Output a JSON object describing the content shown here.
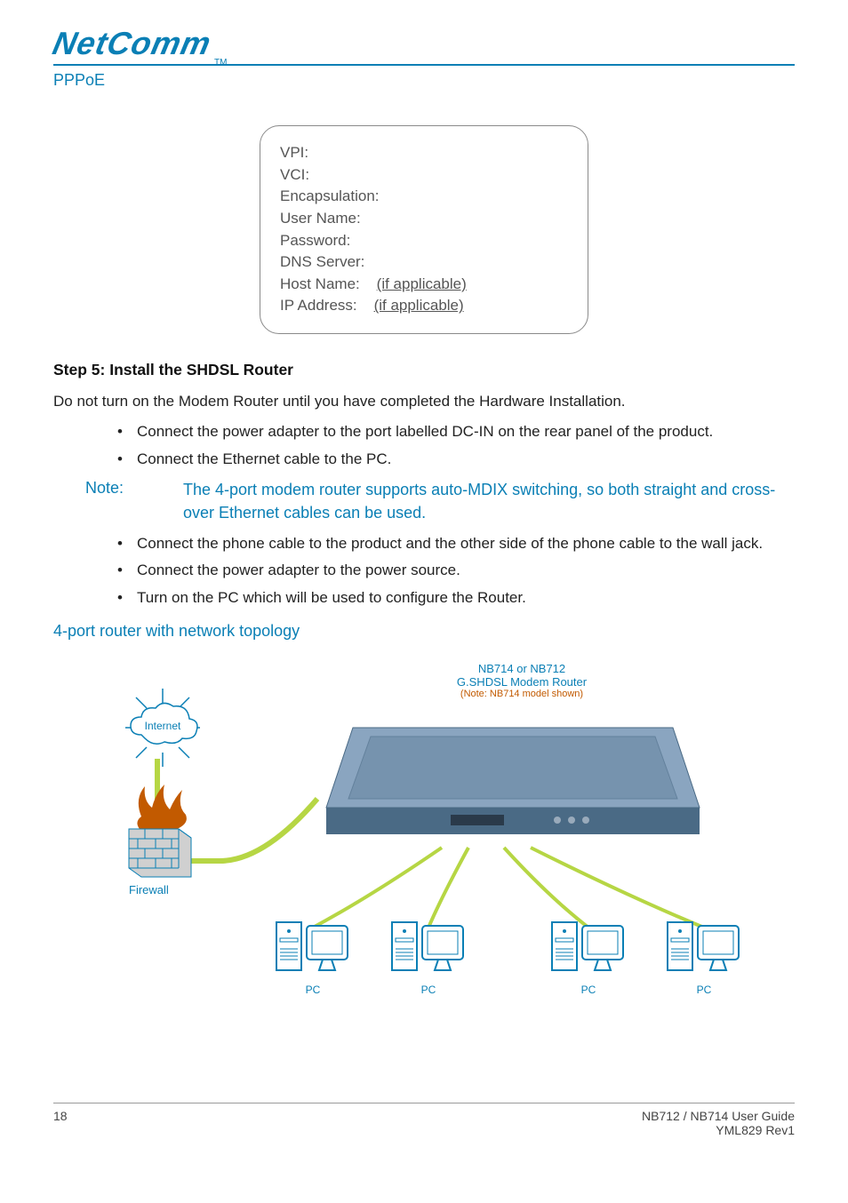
{
  "brand": {
    "name": "NetComm",
    "tm": "TM"
  },
  "section": "PPPoE",
  "callout": {
    "vpi": "VPI:",
    "vci": "VCI:",
    "encapsulation": "Encapsulation:",
    "username": "User Name:",
    "password": "Password:",
    "dns": "DNS Server:",
    "hostname_label": "Host Name:",
    "hostname_suffix": "(if applicable)",
    "ip_label": "IP Address:",
    "ip_suffix": "(if applicable)"
  },
  "step5": {
    "heading": "Step 5: Install the SHDSL Router",
    "intro": "Do not turn on the Modem Router until you have completed the Hardware Installation.",
    "bullets_a": [
      "Connect the power adapter to the port labelled DC-IN on the rear panel of the product.",
      "Connect the Ethernet cable to the PC."
    ],
    "note_label": "Note:",
    "note_text": "The 4-port modem router supports auto-MDIX switching, so both straight and cross-over Ethernet cables can be used.",
    "bullets_b": [
      "Connect the phone cable to the product and the other side of the phone cable to the wall jack.",
      "Connect the power adapter to the power source.",
      "Turn on the PC which will be used to configure the Router."
    ]
  },
  "topology": {
    "heading": "4-port router with network topology",
    "internet": "Internet",
    "firewall": "Firewall",
    "modem_l1": "NB714 or NB712",
    "modem_l2": "G.SHDSL Modem Router",
    "modem_l3": "(Note:  NB714 model shown)",
    "pc": "PC"
  },
  "footer": {
    "page": "18",
    "title": "NB712 / NB714 User Guide",
    "rev": "YML829 Rev1"
  }
}
